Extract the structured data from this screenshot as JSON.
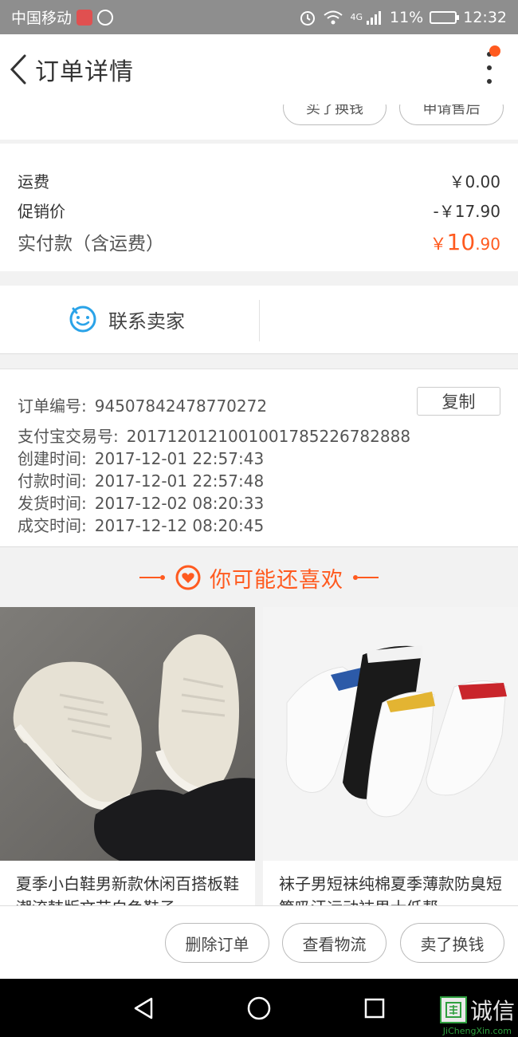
{
  "status_bar": {
    "carrier": "中国移动",
    "network": "4G",
    "battery": "11%",
    "time": "12:32"
  },
  "header": {
    "title": "订单详情"
  },
  "top_actions": {
    "left": "买了换钱",
    "right": "申请售后"
  },
  "price": {
    "shipping_label": "运费",
    "shipping_value": "￥0.00",
    "promo_label": "促销价",
    "promo_value": "-￥17.90",
    "total_label": "实付款（含运费）",
    "total_symbol": "￥",
    "total_int": "10",
    "total_dec": ".90"
  },
  "contact": {
    "label": "联系卖家"
  },
  "order_info": {
    "copy_label": "复制",
    "rows": [
      {
        "label": "订单编号:",
        "value": "94507842478770272"
      },
      {
        "label": "支付宝交易号:",
        "value": "2017120121001001785226782888"
      },
      {
        "label": "创建时间:",
        "value": "2017-12-01 22:57:43"
      },
      {
        "label": "付款时间:",
        "value": "2017-12-01 22:57:48"
      },
      {
        "label": "发货时间:",
        "value": "2017-12-02 08:20:33"
      },
      {
        "label": "成交时间:",
        "value": "2017-12-12 08:20:45"
      }
    ]
  },
  "recommend": {
    "title": "你可能还喜欢",
    "products": [
      {
        "title": "夏季小白鞋男新款休闲百搭板鞋潮流韩版文艺白色鞋子"
      },
      {
        "title": "袜子男短袜纯棉夏季薄款防臭短筒吸汗运动袜男士低帮"
      }
    ]
  },
  "bottom_actions": {
    "delete": "删除订单",
    "logistics": "查看物流",
    "resell": "卖了换钱"
  },
  "watermark": {
    "text": "诚信",
    "sub": "JiChengXin.com"
  },
  "colors": {
    "accent": "#ff5a1f",
    "contact_icon": "#2aa3e8",
    "status_bar": "#8e8e8e"
  }
}
